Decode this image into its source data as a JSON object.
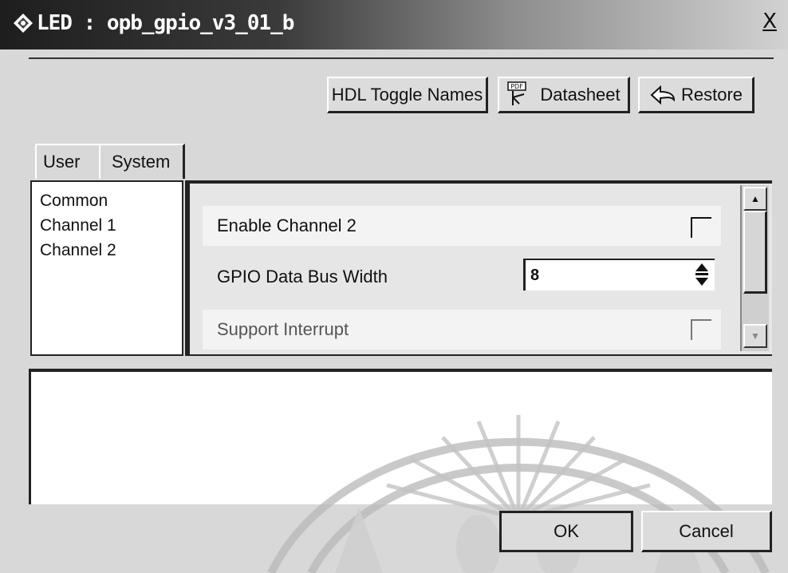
{
  "window": {
    "title": "LED : opb_gpio_v3_01_b",
    "close_label": "X"
  },
  "toolbar": {
    "hdl_toggle_label": "HDL Toggle Names",
    "datasheet_label": "Datasheet",
    "restore_label": "Restore",
    "datasheet_icon_text": "PDF"
  },
  "tabs": [
    {
      "label": "User",
      "selected": true
    },
    {
      "label": "System",
      "selected": false
    }
  ],
  "categories": [
    "Common",
    "Channel 1",
    "Channel 2"
  ],
  "params": {
    "enable_channel_2": {
      "label": "Enable Channel 2",
      "checked": false
    },
    "gpio_width": {
      "label": "GPIO Data Bus Width",
      "value": "8"
    },
    "support_interrupt": {
      "label": "Support Interrupt",
      "checked": false,
      "enabled": false
    }
  },
  "footer": {
    "ok_label": "OK",
    "cancel_label": "Cancel"
  },
  "icons": {
    "title": "diamond-app-icon",
    "datasheet": "pdf-document-icon",
    "restore": "restore-arrow-icon"
  }
}
